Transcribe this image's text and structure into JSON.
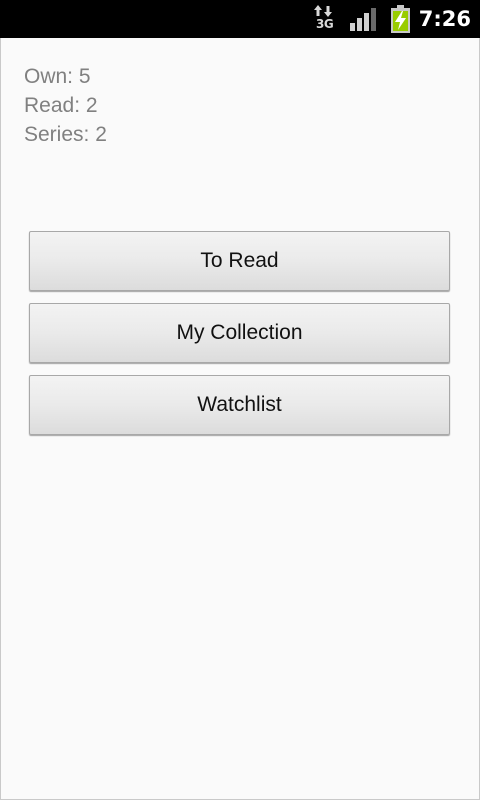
{
  "status_bar": {
    "network_label": "3G",
    "network_icon": "network-3g-icon",
    "signal_icon": "signal-strength-icon",
    "battery_icon": "battery-charging-icon",
    "time": "7:26",
    "battery_color": "#99cc00"
  },
  "stats": {
    "own": "Own: 5",
    "read": "Read: 2",
    "series": "Series: 2"
  },
  "buttons": {
    "to_read": "To Read",
    "my_collection": "My Collection",
    "watchlist": "Watchlist"
  }
}
